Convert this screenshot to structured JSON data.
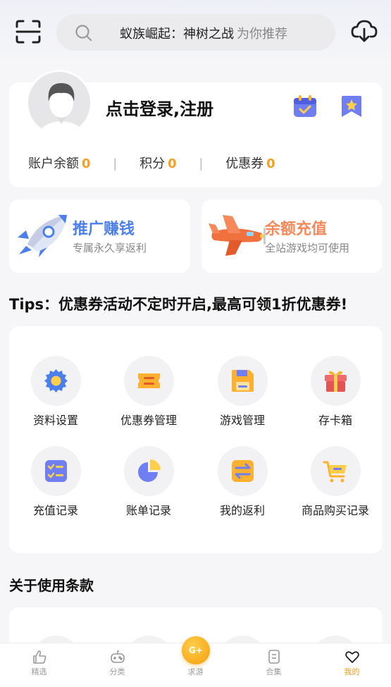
{
  "search": {
    "query": "蚁族崛起：神树之战",
    "hint": "为你推荐"
  },
  "profile": {
    "login_text": "点击登录,注册",
    "stats": [
      {
        "label": "账户余额",
        "value": "0"
      },
      {
        "label": "积分",
        "value": "0"
      },
      {
        "label": "优惠券",
        "value": "0"
      }
    ]
  },
  "promos": [
    {
      "title": "推广赚钱",
      "subtitle": "专属永久享返利"
    },
    {
      "title": "余额充值",
      "subtitle": "全站游戏均可使用"
    }
  ],
  "tips": "Tips：优惠券活动不定时开启,最高可领1折优惠券!",
  "grid": {
    "items": [
      {
        "label": "资料设置",
        "icon": "gear-icon"
      },
      {
        "label": "优惠券管理",
        "icon": "coupon-icon"
      },
      {
        "label": "游戏管理",
        "icon": "save-icon"
      },
      {
        "label": "存卡箱",
        "icon": "gift-box-icon"
      },
      {
        "label": "充值记录",
        "icon": "checklist-icon"
      },
      {
        "label": "账单记录",
        "icon": "pie-chart-icon"
      },
      {
        "label": "我的返利",
        "icon": "exchange-icon"
      },
      {
        "label": "商品购买记录",
        "icon": "cart-icon"
      }
    ]
  },
  "section2": {
    "title": "关于使用条款"
  },
  "tabs": [
    {
      "label": "精选",
      "icon": "thumbs-up-icon"
    },
    {
      "label": "分类",
      "icon": "gamepad-icon"
    },
    {
      "label": "求游",
      "icon": "g-plus-icon"
    },
    {
      "label": "合集",
      "icon": "collection-icon"
    },
    {
      "label": "我的",
      "icon": "heart-icon"
    }
  ],
  "center_button": "G+",
  "colors": {
    "accent": "#f5a020",
    "blue": "#4b7fee",
    "coral": "#f5895a"
  }
}
